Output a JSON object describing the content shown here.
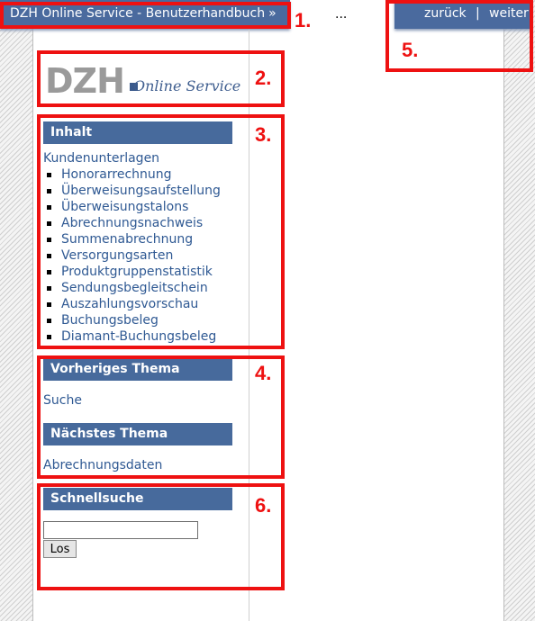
{
  "header": {
    "title": "DZH Online Service - Benutzerhandbuch",
    "title_arrow": "»",
    "ellipsis": "...",
    "nav": {
      "back": "zurück",
      "separator": "|",
      "next": "weiter"
    }
  },
  "logo": {
    "brand": "DZH",
    "tagline": "Online Service"
  },
  "contents": {
    "heading": "Inhalt",
    "parent_link": "Kundenunterlagen",
    "items": [
      "Honorarrechnung",
      "Überweisungsaufstellung",
      "Überweisungstalons",
      "Abrechnungsnachweis",
      "Summenabrechnung",
      "Versorgungsarten",
      "Produktgruppenstatistik",
      "Sendungsbegleitschein",
      "Auszahlungsvorschau",
      "Buchungsbeleg",
      "Diamant-Buchungsbeleg"
    ]
  },
  "previous": {
    "heading": "Vorheriges Thema",
    "link": "Suche"
  },
  "next_topic": {
    "heading": "Nächstes Thema",
    "link": "Abrechnungsdaten"
  },
  "quicksearch": {
    "heading": "Schnellsuche",
    "input_value": "",
    "button_label": "Los"
  },
  "callouts": [
    "1.",
    "2.",
    "3.",
    "4.",
    "5.",
    "6."
  ],
  "colors": {
    "header_blue": "#4a6a9e",
    "link_blue": "#2f5993",
    "callout_red": "#ee1111"
  }
}
